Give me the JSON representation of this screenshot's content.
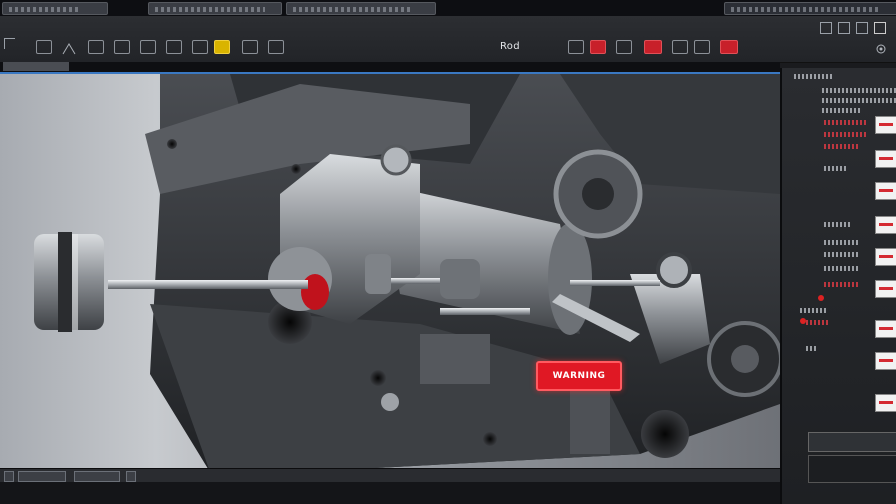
{
  "toolbar": {
    "title": "Rod"
  },
  "viewport": {
    "warning_label": "WARNING"
  },
  "colors": {
    "accent_blue": "#3a78c2",
    "alert_red": "#e01824",
    "toolbar_bg": "#2c2e32"
  }
}
